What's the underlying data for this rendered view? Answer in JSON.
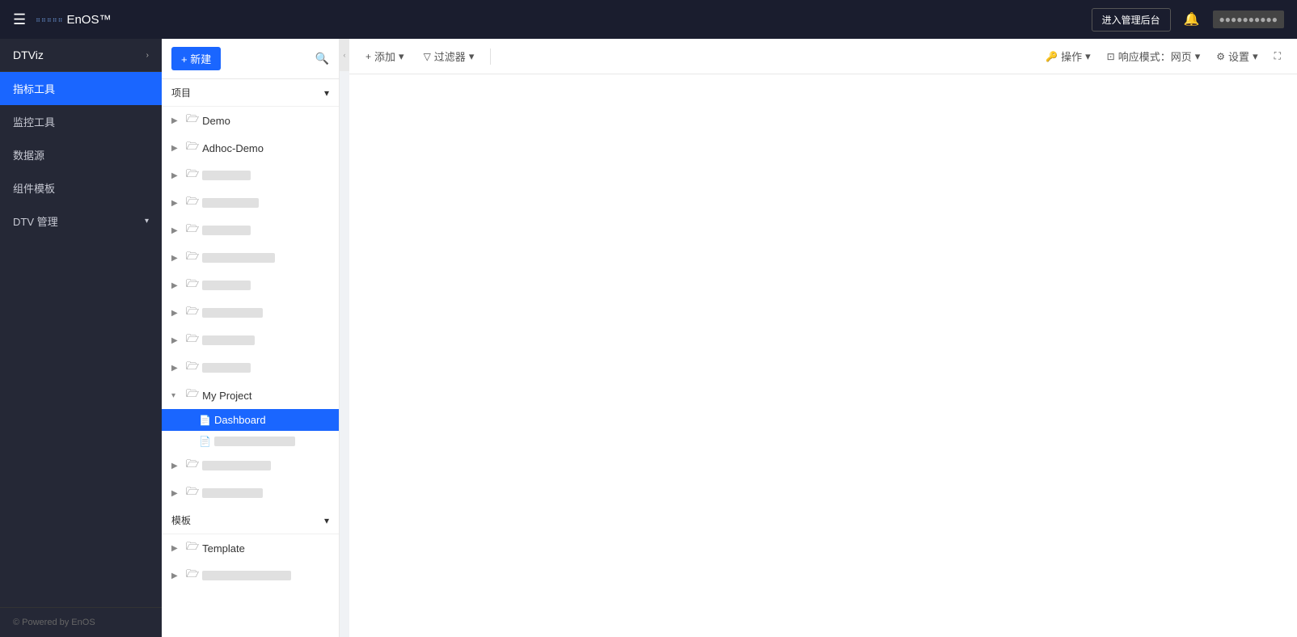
{
  "topnav": {
    "hamburger": "☰",
    "logo_dots": "····· ·····",
    "logo_name": "EnOS™",
    "admin_btn": "进入管理后台",
    "bell": "🔔",
    "user": "●●●●●●●●●●"
  },
  "sidebar": {
    "brand": "DTViz",
    "items": [
      {
        "label": "指标工具",
        "active": true
      },
      {
        "label": "监控工具",
        "active": false
      },
      {
        "label": "数据源",
        "active": false
      },
      {
        "label": "组件模板",
        "active": false
      },
      {
        "label": "DTV 管理",
        "active": false,
        "hasArrow": true
      }
    ],
    "footer": "© Powered by EnOS"
  },
  "filetree": {
    "new_btn": "+ 新建",
    "sections": [
      {
        "label": "项目",
        "items": [
          {
            "type": "folder",
            "label": "Demo",
            "indent": 0,
            "expanded": false
          },
          {
            "type": "folder",
            "label": "Adhoc-Demo",
            "indent": 0,
            "expanded": false
          },
          {
            "type": "folder",
            "label": "blurred1",
            "indent": 0,
            "blurred": true
          },
          {
            "type": "folder",
            "label": "blurred2",
            "indent": 0,
            "blurred": true
          },
          {
            "type": "folder",
            "label": "blurred3",
            "indent": 0,
            "blurred": true
          },
          {
            "type": "folder",
            "label": "blurred4",
            "indent": 0,
            "blurred": true
          },
          {
            "type": "folder",
            "label": "blurred5",
            "indent": 0,
            "blurred": true
          },
          {
            "type": "folder",
            "label": "blurred6",
            "indent": 0,
            "blurred": true
          },
          {
            "type": "folder",
            "label": "blurred7",
            "indent": 0,
            "blurred": true
          },
          {
            "type": "folder",
            "label": "blurred8",
            "indent": 0,
            "blurred": true
          },
          {
            "type": "folder",
            "label": "My Project",
            "indent": 0,
            "expanded": true
          },
          {
            "type": "file",
            "label": "Dashboard",
            "indent": 1,
            "active": true
          },
          {
            "type": "file",
            "label": "blurred_file",
            "indent": 1,
            "blurred": true
          },
          {
            "type": "folder",
            "label": "blurred9",
            "indent": 0,
            "blurred": true
          },
          {
            "type": "folder",
            "label": "blurred10",
            "indent": 0,
            "blurred": true
          }
        ]
      },
      {
        "label": "模板",
        "items": [
          {
            "type": "folder",
            "label": "Template",
            "indent": 0,
            "expanded": false
          },
          {
            "type": "folder",
            "label": "blurred_tpl",
            "indent": 0,
            "blurred": true
          }
        ]
      }
    ]
  },
  "toolbar": {
    "add": "添加",
    "filter": "过滤器",
    "operate": "操作",
    "responsive": "响应模式：网页",
    "settings": "设置",
    "fullscreen": "⛶"
  }
}
